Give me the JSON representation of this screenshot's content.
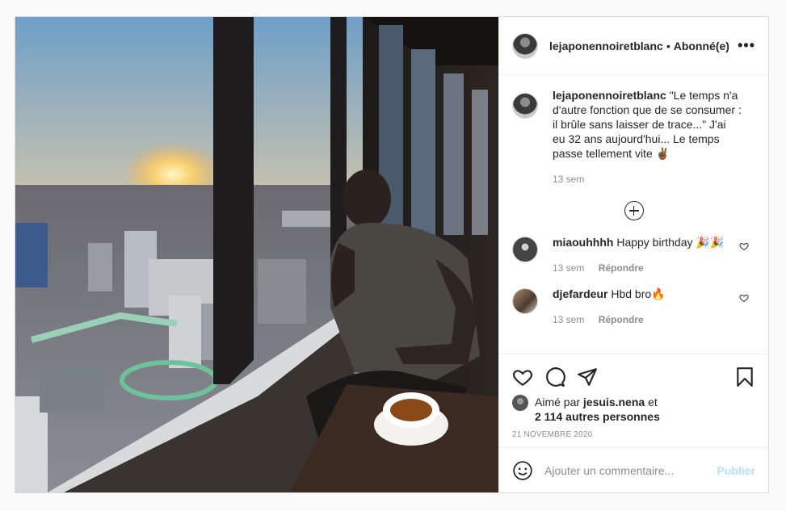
{
  "post": {
    "username": "lejaponennoiretblanc",
    "separator": "•",
    "follow_status": "Abonné(e)",
    "more": "•••",
    "caption": {
      "username": "lejaponennoiretblanc",
      "text": "\"Le temps n'a d'autre fonction que de se consumer : il brûle sans laisser de trace...\" J'ai eu 32 ans aujourd'hui... Le temps passe tellement vite ✌🏾",
      "time": "13 sem"
    },
    "comments": [
      {
        "username": "miaouhhhh",
        "text": "Happy birthday 🎉🎉",
        "time": "13 sem",
        "reply": "Répondre"
      },
      {
        "username": "djefardeur",
        "text": "Hbd bro🔥",
        "time": "13 sem",
        "reply": "Répondre"
      }
    ],
    "likes": {
      "prefix": "Aimé par",
      "user": "jesuis.nena",
      "conjunction": "et",
      "others": "2 114 autres personnes"
    },
    "date": "21 NOVEMBRE 2020",
    "add_comment": {
      "placeholder": "Ajouter un commentaire...",
      "publish": "Publier"
    }
  },
  "icons": {
    "more": "more-icon",
    "plus": "plus-circle-icon",
    "heart": "heart-icon",
    "comment": "comment-icon",
    "share": "share-icon",
    "save": "bookmark-icon",
    "emoji": "emoji-icon"
  },
  "colors": {
    "border": "#dbdbdb",
    "muted": "#8e8e8e",
    "publish_disabled": "#b2dffc"
  }
}
